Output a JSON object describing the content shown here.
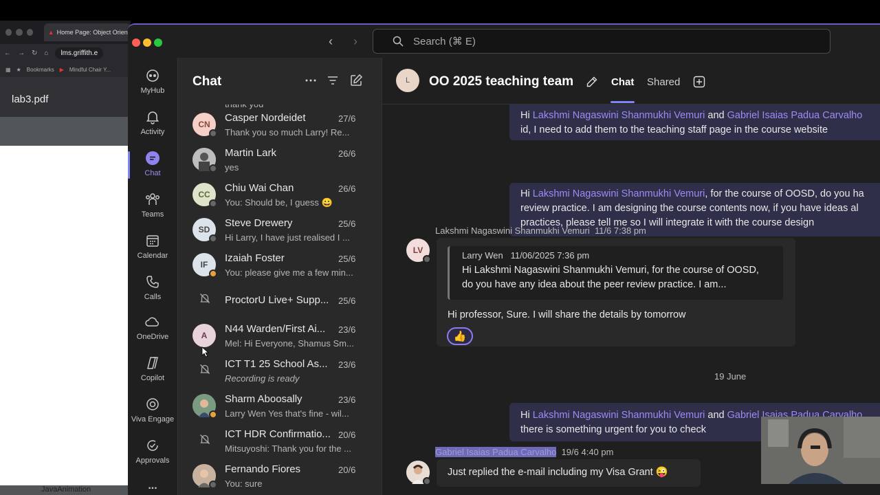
{
  "browser": {
    "tab_title": "Home Page: Object Oriente",
    "url": "lms.griffith.e",
    "bookmarks": [
      "Bookmarks",
      "Mindful Chair Y..."
    ],
    "pdf_title": "lab3.pdf",
    "bottom_text": "JavaAnimation"
  },
  "window": {
    "search_placeholder": "Search (⌘ E)"
  },
  "rail": {
    "items": [
      {
        "label": "MyHub",
        "icon": "myhub-icon"
      },
      {
        "label": "Activity",
        "icon": "bell-icon"
      },
      {
        "label": "Chat",
        "icon": "chat-icon"
      },
      {
        "label": "Teams",
        "icon": "teams-icon"
      },
      {
        "label": "Calendar",
        "icon": "calendar-icon"
      },
      {
        "label": "Calls",
        "icon": "phone-icon"
      },
      {
        "label": "OneDrive",
        "icon": "cloud-icon"
      },
      {
        "label": "Copilot",
        "icon": "copilot-icon"
      },
      {
        "label": "Viva Engage",
        "icon": "viva-icon"
      },
      {
        "label": "Approvals",
        "icon": "approvals-icon"
      }
    ],
    "more": "..."
  },
  "chatlist": {
    "title": "Chat",
    "partial_top_preview": "thank you",
    "chats": [
      {
        "name": "Casper Nordeidet",
        "date": "27/6",
        "preview": "Thank you so much Larry! Re...",
        "initials": "CN",
        "avatar_color": "#f5d0c6"
      },
      {
        "name": "Martin Lark",
        "date": "26/6",
        "preview": "yes",
        "initials": "",
        "avatar_color": "#9a9a9a"
      },
      {
        "name": "Chiu Wai Chan",
        "date": "26/6",
        "preview": "You: Should be, I guess 😀",
        "initials": "CC",
        "avatar_color": "#dfe3c9"
      },
      {
        "name": "Steve Drewery",
        "date": "25/6",
        "preview": "Hi Larry, I have just realised I ...",
        "initials": "SD",
        "avatar_color": "#dde3ea"
      },
      {
        "name": "Izaiah Foster",
        "date": "25/6",
        "preview": "You: please give me a few min...",
        "initials": "IF",
        "avatar_color": "#dde3ea"
      },
      {
        "name": "ProctorU Live+ Supp...",
        "date": "25/6",
        "preview": "",
        "initials": "",
        "avatar_color": ""
      },
      {
        "name": "N44 Warden/First Ai...",
        "date": "23/6",
        "preview": "Mel: Hi Everyone, Shamus Sm...",
        "initials": "A",
        "avatar_color": "#e8d2dc"
      },
      {
        "name": "ICT T1 25 School As...",
        "date": "23/6",
        "preview": "Recording is ready",
        "initials": "",
        "avatar_color": ""
      },
      {
        "name": "Sharm Aboosally",
        "date": "23/6",
        "preview": "Larry Wen Yes that's fine - wil...",
        "initials": "",
        "avatar_color": "#6f8f7a"
      },
      {
        "name": "ICT HDR Confirmatio...",
        "date": "20/6",
        "preview": "Mitsuyoshi: Thank you for the ...",
        "initials": "",
        "avatar_color": ""
      },
      {
        "name": "Fernando Fiores",
        "date": "20/6",
        "preview": "You: sure",
        "initials": "",
        "avatar_color": "#b89a86"
      }
    ]
  },
  "main": {
    "group_name": "OO 2025 teaching team",
    "group_avatar_initial": "L",
    "tab_chat": "Chat",
    "tab_shared": "Shared",
    "msg1": {
      "l1_a": "Hi ",
      "l1_m1": "Lakshmi Nagaswini Shanmukhi Vemuri",
      "l1_b": " and ",
      "l1_m2": "Gabriel Isaias Padua Carvalho",
      "l2": "id, I need to add them to the teaching staff page in the course website"
    },
    "msg2": {
      "l1_a": "Hi ",
      "l1_m1": "Lakshmi Nagaswini Shanmukhi Vemuri",
      "l1_b": ", for the course of OOSD, do you ha",
      "l2": "review practice. I am designing the course contents now, if you have ideas al",
      "l3": "practices, please tell me so I will integrate it with the course design"
    },
    "msg3": {
      "sender": "Lakshmi Nagaswini Shanmukhi Vemuri",
      "time": "11/6 7:38 pm",
      "initials": "LV",
      "quote_sender": "Larry Wen",
      "quote_time": "11/06/2025 7:36 pm",
      "quote_l1": "Hi Lakshmi Nagaswini Shanmukhi Vemuri, for the course of OOSD,",
      "quote_l2": "do you have any idea about the peer review practice. I am...",
      "text": "Hi professor, Sure. I will share the details by tomorrow",
      "reaction": "👍"
    },
    "date_separator": "19 June",
    "msg4": {
      "l1_a": "Hi ",
      "l1_m1": "Lakshmi Nagaswini Shanmukhi Vemuri",
      "l1_b": " and ",
      "l1_m2": "Gabriel Isaias Padua Carvalho",
      "l2": "there is something urgent for you to check"
    },
    "msg5": {
      "sender": "Gabriel Isaias Padua Carvalho",
      "time": "19/6 4:40 pm",
      "text": "Just replied the e-mail including my Visa Grant 😜"
    }
  },
  "colors": {
    "accent": "#7f85f5",
    "mention": "#9b8cf2",
    "bubble_out": "#2f2f4a"
  }
}
